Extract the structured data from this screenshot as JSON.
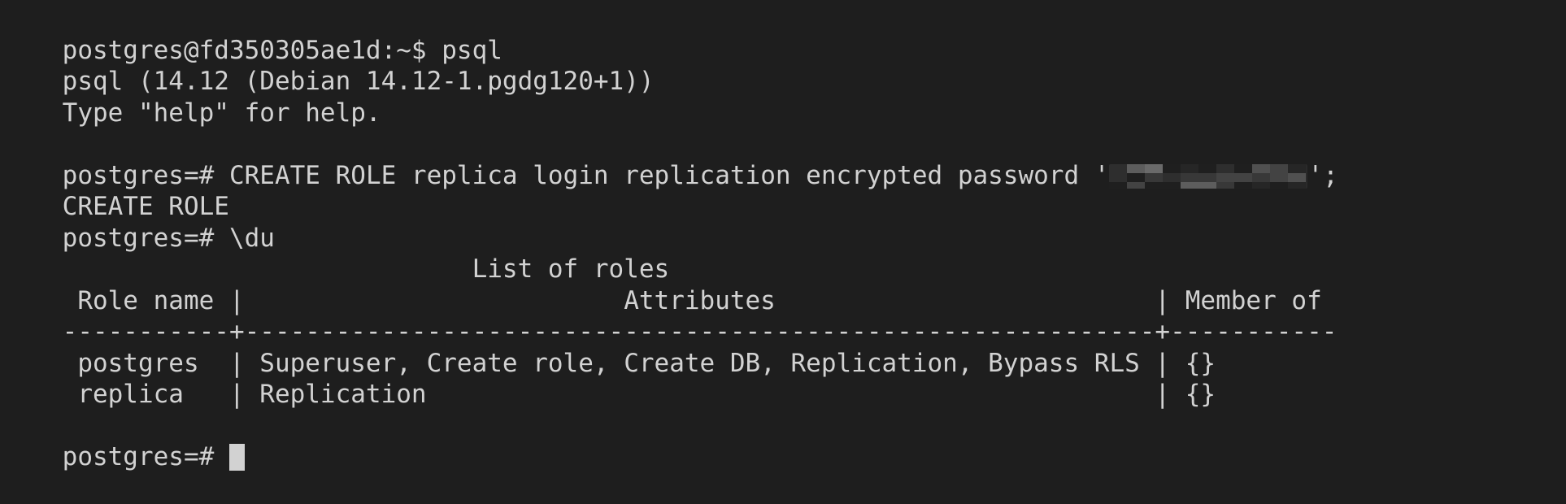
{
  "terminal": {
    "background_color": "#1e1e1e",
    "foreground_color": "#d2d2d2",
    "cursor_color": "#d2d2d2",
    "lines": [
      {
        "id": "shell-prompt-psql",
        "text": "postgres@fd350305ae1d:~$ psql"
      },
      {
        "id": "psql-version",
        "text": "psql (14.12 (Debian 14.12-1.pgdg120+1))"
      },
      {
        "id": "psql-help-hint",
        "text": "Type \"help\" for help."
      },
      {
        "id": "blank-1",
        "text": ""
      },
      {
        "id": "create-role-cmd",
        "text": ""
      },
      {
        "id": "create-role-result",
        "text": "CREATE ROLE"
      },
      {
        "id": "du-cmd",
        "text": "postgres=# \\du"
      },
      {
        "id": "table-title",
        "text": "                           List of roles"
      },
      {
        "id": "table-header",
        "text": " Role name |                         Attributes                         | Member of "
      },
      {
        "id": "table-rule",
        "text": "-----------+------------------------------------------------------------+-----------"
      },
      {
        "id": "row-postgres",
        "text": " postgres  | Superuser, Create role, Create DB, Replication, Bypass RLS | {}"
      },
      {
        "id": "row-replica",
        "text": " replica   | Replication                                                | {}"
      },
      {
        "id": "blank-2",
        "text": ""
      },
      {
        "id": "final-prompt",
        "text": ""
      }
    ],
    "create_role_command": {
      "prompt": "postgres=# ",
      "statement_before_password": "CREATE ROLE replica login replication encrypted password '",
      "password_value": "",
      "password_redacted": true,
      "statement_after_password": "';"
    },
    "final_prompt": {
      "prompt": "postgres=# ",
      "input_value": "",
      "cursor_visible": true
    },
    "roles_table": {
      "title": "List of roles",
      "columns": [
        "Role name",
        "Attributes",
        "Member of"
      ],
      "rows": [
        {
          "role_name": "postgres",
          "attributes": "Superuser, Create role, Create DB, Replication, Bypass RLS",
          "member_of": "{}"
        },
        {
          "role_name": "replica",
          "attributes": "Replication",
          "member_of": "{}"
        }
      ]
    }
  }
}
